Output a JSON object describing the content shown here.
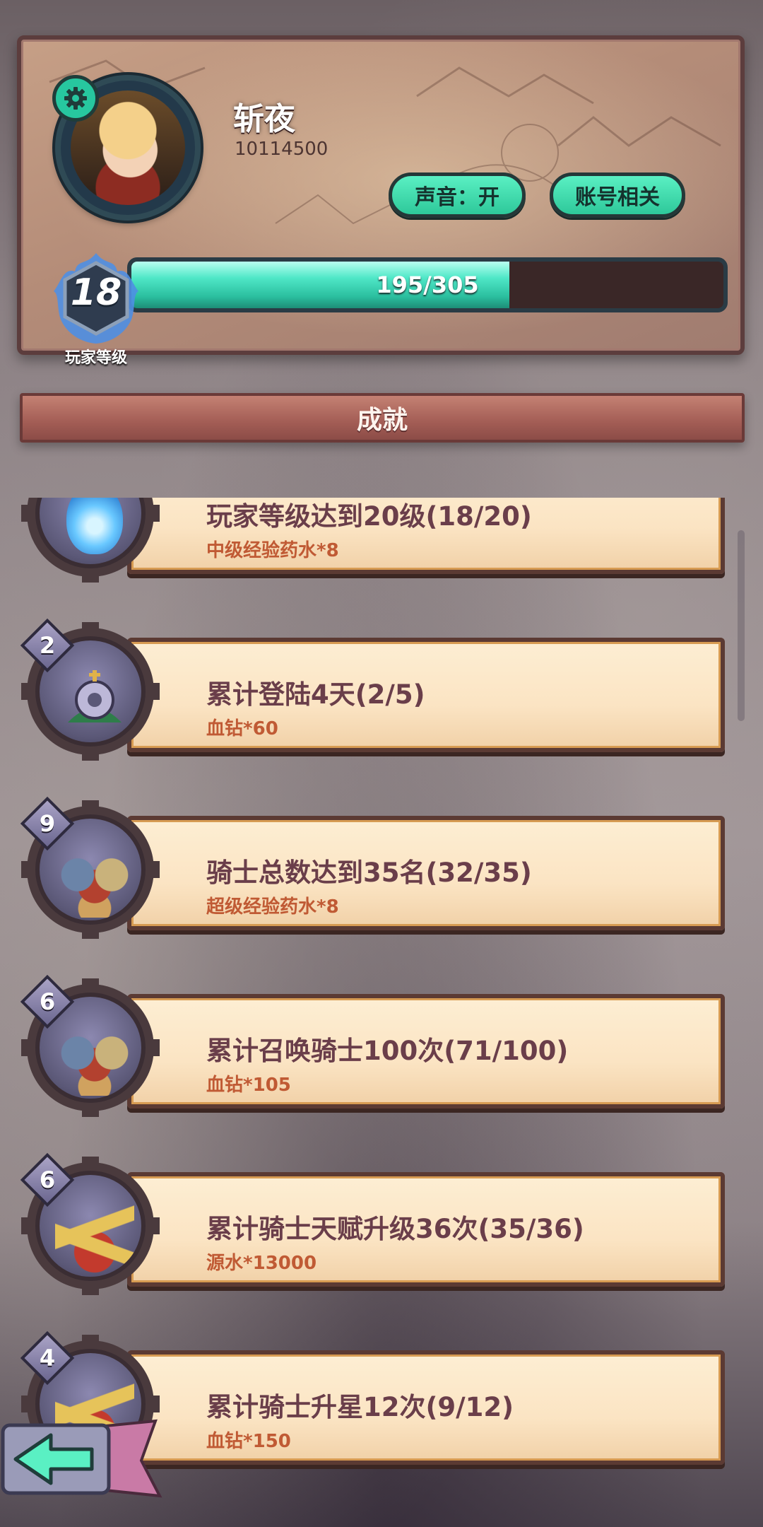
{
  "player": {
    "name": "斩夜",
    "id": "10114500",
    "level": "18",
    "level_caption": "玩家等级",
    "xp_text": "195/305",
    "xp_fraction": 0.639
  },
  "buttons": {
    "sound": "声音：开",
    "account": "账号相关"
  },
  "section_title": "成就",
  "achievements": [
    {
      "title": "玩家等级达到20级(18/20)",
      "reward": "中级经验药水*8",
      "badge": "",
      "icon": "blue-flame-icon"
    },
    {
      "title": "累计登陆4天(2/5)",
      "reward": "血钻*60",
      "badge": "2",
      "icon": "gear-crown-icon"
    },
    {
      "title": "骑士总数达到35名(32/35)",
      "reward": "超级经验药水*8",
      "badge": "9",
      "icon": "knights-group-icon"
    },
    {
      "title": "累计召唤骑士100次(71/100)",
      "reward": "血钻*105",
      "badge": "6",
      "icon": "knights-group-icon"
    },
    {
      "title": "累计骑士天赋升级36次(35/36)",
      "reward": "源水*13000",
      "badge": "6",
      "icon": "straw-hat-knight-icon"
    },
    {
      "title": "累计骑士升星12次(9/12)",
      "reward": "血钻*150",
      "badge": "4",
      "icon": "straw-hat-knight-icon"
    }
  ],
  "colors": {
    "accent_teal": "#2ec89a",
    "card_title": "#6a3e4a",
    "card_reward": "#c05a34",
    "banner": "#a35d55"
  }
}
